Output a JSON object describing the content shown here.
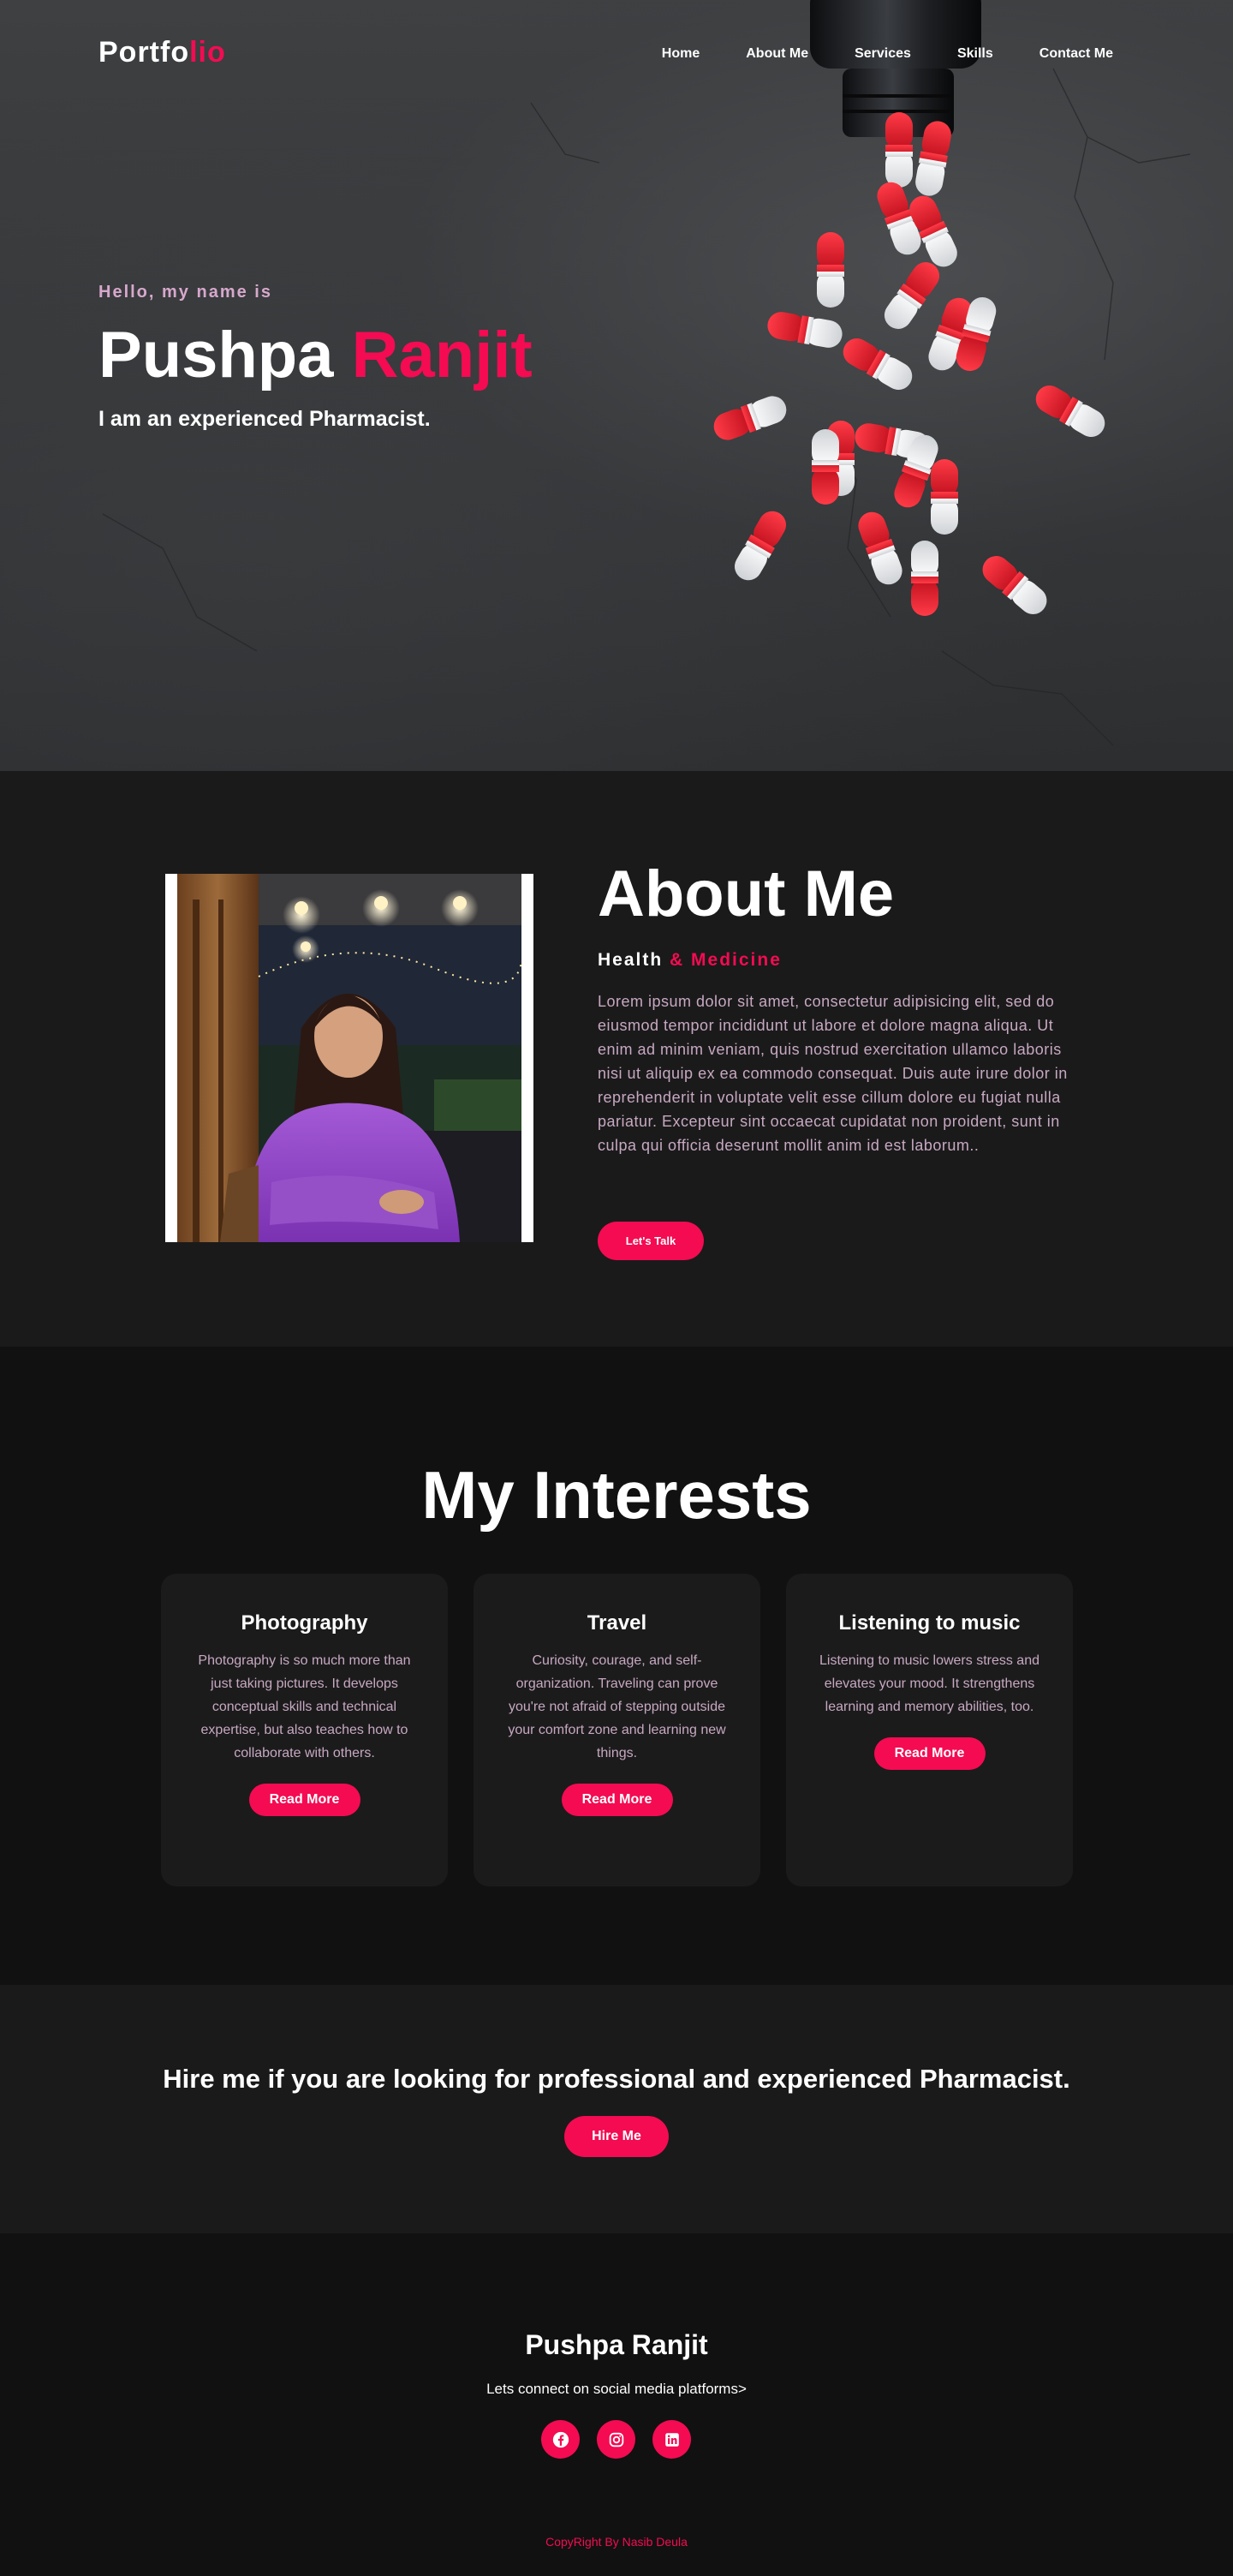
{
  "nav": {
    "logo_main": "Portfo",
    "logo_accent": "lio",
    "links": [
      "Home",
      "About Me",
      "Services",
      "Skills",
      "Contact Me"
    ]
  },
  "hero": {
    "greeting": "Hello, my name is",
    "first_name": "Pushpa",
    "last_name": "Ranjit",
    "tagline": "I am an experienced Pharmacist."
  },
  "about": {
    "title": "About Me",
    "subtitle_main": "Health",
    "subtitle_accent": "& Medicine",
    "body": "Lorem ipsum dolor sit amet, consectetur adipisicing elit, sed do eiusmod tempor incididunt ut labore et dolore magna aliqua. Ut enim ad minim veniam, quis nostrud exercitation ullamco laboris nisi ut aliquip ex ea commodo consequat. Duis aute irure dolor in reprehenderit in voluptate velit esse cillum dolore eu fugiat nulla pariatur. Excepteur sint occaecat cupidatat non proident, sunt in culpa qui officia deserunt mollit anim id est laborum..",
    "button": "Let's Talk"
  },
  "interests": {
    "title": "My Interests",
    "cards": [
      {
        "title": "Photography",
        "text": "Photography is so much more than just taking pictures. It develops conceptual skills and technical expertise, but also teaches how to collaborate with others.",
        "button": "Read More"
      },
      {
        "title": "Travel",
        "text": "Curiosity, courage, and self-organization. Traveling can prove you're not afraid of stepping outside your comfort zone and learning new things.",
        "button": "Read More"
      },
      {
        "title": "Listening to music",
        "text": "Listening to music lowers stress and elevates your mood. It strengthens learning and memory abilities, too.",
        "button": "Read More"
      }
    ]
  },
  "hire": {
    "heading": "Hire me if you are looking for professional and experienced Pharmacist.",
    "button": "Hire Me"
  },
  "footer": {
    "name": "Pushpa Ranjit",
    "connect": "Lets connect on social media platforms>",
    "socials": [
      "facebook-icon",
      "instagram-icon",
      "linkedin-icon"
    ],
    "copyright": "CopyRight By Nasib Deula"
  },
  "colors": {
    "accent": "#f40b52",
    "muted_text": "#c7a8c2",
    "greeting": "#d7a8cc",
    "section_dark": "#111111",
    "section_mid": "#1a1a1a"
  }
}
